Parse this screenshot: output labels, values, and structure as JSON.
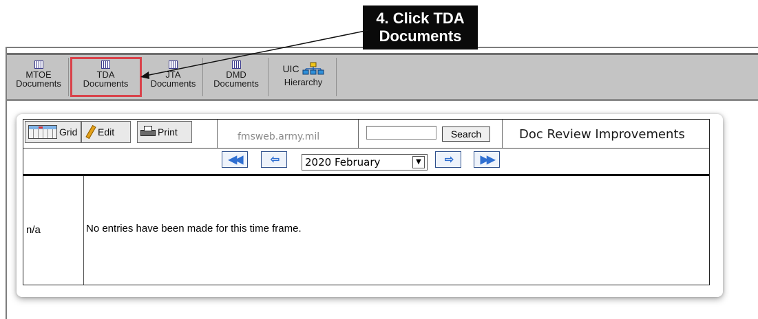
{
  "callout": {
    "line1": "4. Click  TDA",
    "line2": "Documents"
  },
  "toolbar": {
    "buttons": [
      {
        "line1": "MTOE",
        "line2": "Documents",
        "icon": "document-grid-icon",
        "highlighted": false
      },
      {
        "line1": "TDA",
        "line2": "Documents",
        "icon": "document-grid-icon",
        "highlighted": true
      },
      {
        "line1": "JTA",
        "line2": "Documents",
        "icon": "document-grid-icon",
        "highlighted": false
      },
      {
        "line1": "DMD",
        "line2": "Documents",
        "icon": "document-grid-icon",
        "highlighted": false
      },
      {
        "line1": "UIC",
        "line2": "Hierarchy",
        "icon": "hierarchy-icon",
        "highlighted": false
      }
    ],
    "highlight_color": "#d9424a"
  },
  "panel": {
    "grid_label": "Grid",
    "edit_label": "Edit",
    "print_label": "Print",
    "site": "fmsweb.army.mil",
    "search_value": "",
    "search_button": "Search",
    "title": "Doc Review Improvements",
    "nav": {
      "first_icon": "double-left-arrow-icon",
      "prev_icon": "left-arrow-icon",
      "next_icon": "right-arrow-icon",
      "last_icon": "double-right-arrow-icon"
    },
    "month_selected": "2020 February",
    "row_label": "n/a",
    "empty_message": "No entries have been made for this time frame."
  }
}
